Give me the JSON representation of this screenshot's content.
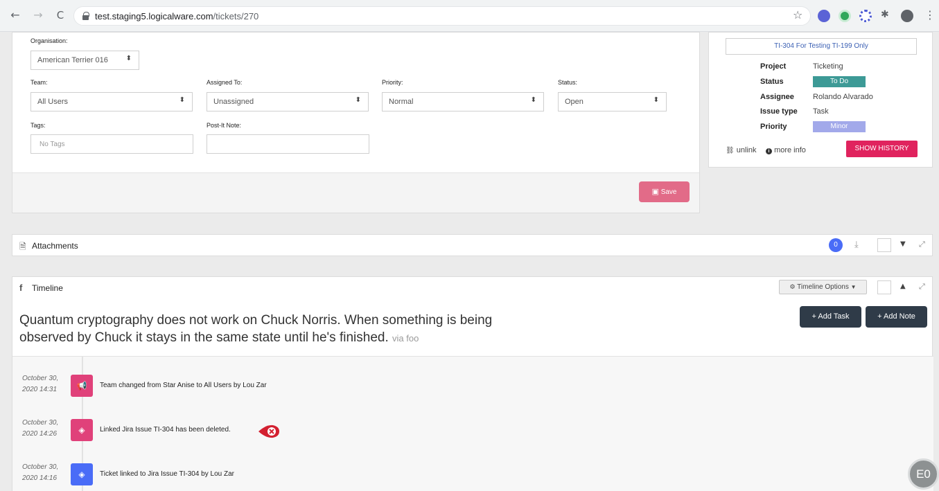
{
  "browser": {
    "back": "←",
    "forward": "→",
    "reload": "C",
    "url_domain": "test.staging5.logicalware.com",
    "url_path": "/tickets/270",
    "star": "☆",
    "menu": "⋮"
  },
  "form": {
    "organisation_label": "Organisation:",
    "organisation_value": "American Terrier 016",
    "team_label": "Team:",
    "team_value": "All Users",
    "assigned_label": "Assigned To:",
    "assigned_value": "Unassigned",
    "priority_label": "Priority:",
    "priority_value": "Normal",
    "status_label": "Status:",
    "status_value": "Open",
    "tags_label": "Tags:",
    "tags_placeholder": "No Tags",
    "postit_label": "Post-It Note:",
    "postit_value": "",
    "save_label": "Save"
  },
  "jira": {
    "issue_title": "TI-304 For Testing TI-199 Only",
    "fields": [
      {
        "label": "Project",
        "value": "Ticketing"
      },
      {
        "label": "Status",
        "value": "To Do"
      },
      {
        "label": "Assignee",
        "value": "Rolando Alvarado"
      },
      {
        "label": "Issue type",
        "value": "Task"
      },
      {
        "label": "Priority",
        "value": "Minor"
      }
    ],
    "status_color": "#3d9a96",
    "priority_color": "#a2a9ea",
    "unlink_label": "unlink",
    "more_info_label": "more info",
    "show_history_label": "SHOW HISTORY"
  },
  "attachments": {
    "title": "Attachments",
    "count": "0"
  },
  "timeline": {
    "title": "Timeline",
    "options_label": "Timeline Options",
    "quote": "Quantum cryptography does not work on Chuck Norris. When something is being observed by Chuck it stays in the same state until he's finished.",
    "quote_source": "via foo",
    "add_task_label": "+ Add Task",
    "add_note_label": "+ Add Note",
    "events": [
      {
        "date_line1": "October 30,",
        "date_line2": "2020 14:31",
        "text": "Team changed from Star Anise to All Users by Lou Zar",
        "icon": "megaphone-icon",
        "color": "#e0417a"
      },
      {
        "date_line1": "October 30,",
        "date_line2": "2020 14:26",
        "text": "Linked Jira Issue TI-304 has been deleted.",
        "icon": "jira-diamond-icon",
        "color": "#e0417a"
      },
      {
        "date_line1": "October 30,",
        "date_line2": "2020 14:16",
        "text": "Ticket linked to Jira Issue TI-304 by Lou Zar",
        "icon": "jira-diamond-icon",
        "color": "#4a6cf7"
      }
    ]
  },
  "avatar_initials": "E0"
}
